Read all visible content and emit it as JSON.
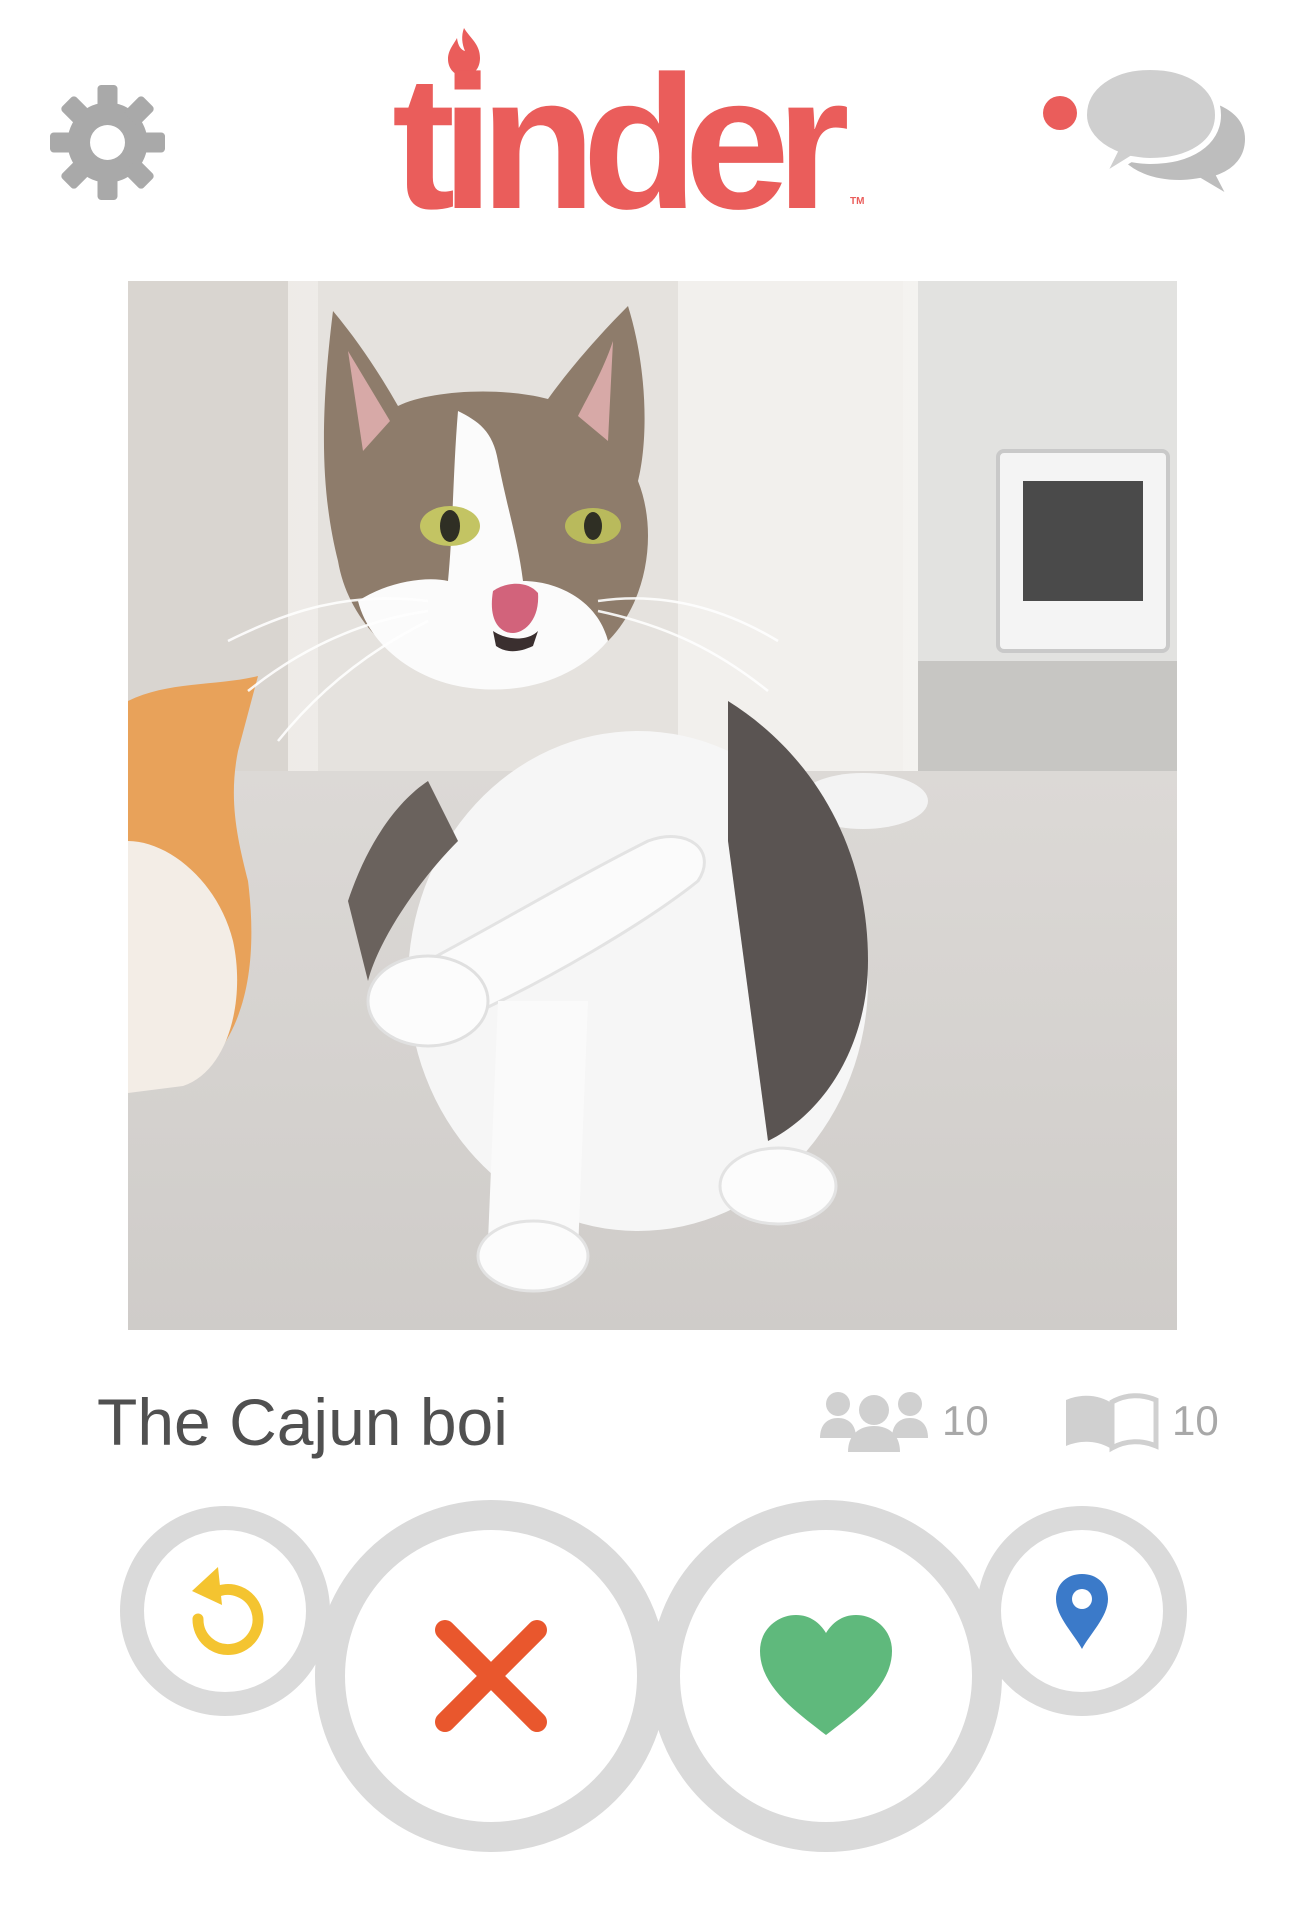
{
  "app": {
    "logo_text": "tinder",
    "logo_tm": "TM",
    "brand_color": "#ea5d5b",
    "has_unread_messages": true
  },
  "header": {
    "settings_icon": "gear-icon",
    "messages_icon": "chat-bubbles-icon"
  },
  "profile": {
    "photo_subject": "tabby and white cat licking nose with paw raised",
    "name": "The Cajun boi",
    "friends_count": "10",
    "interests_count": "10",
    "friends_icon": "mutual-friends-icon",
    "interests_icon": "interests-book-icon"
  },
  "actions": [
    {
      "name": "rewind",
      "icon": "rewind-icon",
      "color": "#f4c430"
    },
    {
      "name": "nope",
      "icon": "close-icon",
      "color": "#e9572d"
    },
    {
      "name": "like",
      "icon": "heart-icon",
      "color": "#5fb97c"
    },
    {
      "name": "location",
      "icon": "location-pin-icon",
      "color": "#3b7ac9"
    }
  ]
}
